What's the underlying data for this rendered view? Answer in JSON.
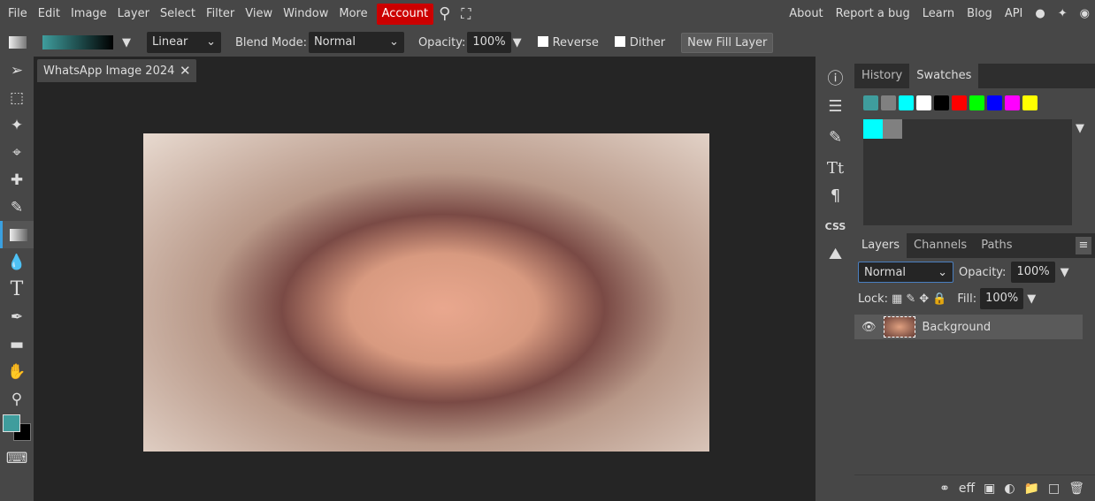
{
  "menu": [
    "File",
    "Edit",
    "Image",
    "Layer",
    "Select",
    "Filter",
    "View",
    "Window",
    "More"
  ],
  "account": "Account",
  "right_menu": [
    "About",
    "Report a bug",
    "Learn",
    "Blog",
    "API"
  ],
  "options": {
    "gradient_type": "Linear",
    "blend_label": "Blend Mode:",
    "blend_value": "Normal",
    "opacity_label": "Opacity:",
    "opacity": "100%",
    "reverse": "Reverse",
    "dither": "Dither",
    "new_fill": "New Fill Layer"
  },
  "doc_tab": "WhatsApp Image 2024-",
  "colors": {
    "foreground": "#3f9d9d",
    "background": "#000000",
    "accent": "#c00000"
  },
  "panel_top": {
    "tabs": [
      "History",
      "Swatches"
    ],
    "active": "Swatches",
    "swatches": [
      "#3f9d9d",
      "#808080",
      "#00ffff",
      "#ffffff",
      "#000000",
      "#ff0000",
      "#00ff00",
      "#0000ff",
      "#ff00ff",
      "#ffff00"
    ],
    "recent": [
      "#00ffff",
      "#808080"
    ]
  },
  "layers": {
    "tabs": [
      "Layers",
      "Channels",
      "Paths"
    ],
    "blend": "Normal",
    "opacity_label": "Opacity:",
    "opacity": "100%",
    "lock_label": "Lock:",
    "fill_label": "Fill:",
    "fill": "100%",
    "items": [
      {
        "name": "Background",
        "visible": true
      }
    ]
  },
  "side_icons": {
    "css": "CSS"
  }
}
